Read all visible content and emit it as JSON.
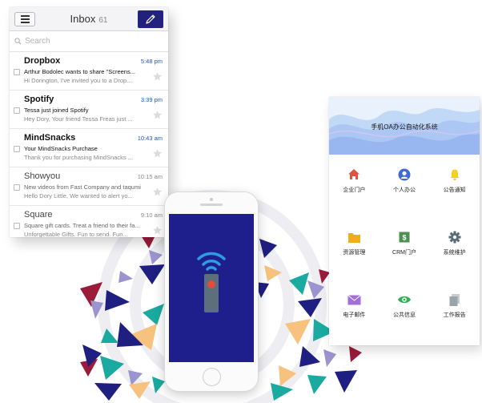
{
  "inbox": {
    "title": "Inbox",
    "count": "61",
    "search_placeholder": "Search",
    "messages": [
      {
        "sender": "Dropbox",
        "time": "5:48 pm",
        "subject": "Arthur Bodolec wants to share \"Screens...",
        "preview": "Hi Dorington, I've invited you to a Drop...",
        "unread": true
      },
      {
        "sender": "Spotify",
        "time": "3:39 pm",
        "subject": "Tessa just joined Spotify",
        "preview": "Hey Dory, Your friend Tessa Freas just ...",
        "unread": true
      },
      {
        "sender": "MindSnacks",
        "time": "10:43 am",
        "subject": "Your MindSnacks Purchase",
        "preview": "Thank you for purchasing MindSnacks ...",
        "unread": true
      },
      {
        "sender": "Showyou",
        "time": "10:15 am",
        "subject": "New videos from Fast Company and taqumi",
        "preview": "Hello Dory Little, We wanted to alert yo...",
        "unread": false
      },
      {
        "sender": "Square",
        "time": "9:10 am",
        "subject": "Square gift cards. Treat a friend to their fa...",
        "preview": "Unforgettable Gifts. Fun to send. Fun...",
        "unread": false
      }
    ]
  },
  "phone": {
    "screen_icon": "wifi-remote-icon",
    "colors": {
      "screen": "#1e1e8c",
      "signal": "#2f9be6",
      "remote": "#5c6f7d",
      "button": "#e24c3a"
    }
  },
  "oa": {
    "title": "手机OA办公自动化系统",
    "items": [
      {
        "label": "企业门户",
        "icon": "home-icon",
        "color": "#e0533f"
      },
      {
        "label": "个人办公",
        "icon": "person-icon",
        "color": "#3f6ad8"
      },
      {
        "label": "公告通知",
        "icon": "bell-icon",
        "color": "#f1d21e"
      },
      {
        "label": "资源管理",
        "icon": "folder-icon",
        "color": "#f2ae14"
      },
      {
        "label": "CRM门户",
        "icon": "crm-icon",
        "color": "#4e8f52"
      },
      {
        "label": "系统维护",
        "icon": "gear-icon",
        "color": "#566a78"
      },
      {
        "label": "电子邮件",
        "icon": "mail-icon",
        "color": "#a06fd8"
      },
      {
        "label": "公共信息",
        "icon": "eye-icon",
        "color": "#2eae57"
      },
      {
        "label": "工作报告",
        "icon": "report-icon",
        "color": "#9ba4ac"
      }
    ]
  },
  "colors": {
    "accent": "#22227e",
    "link": "#1a56c9",
    "triangle_navy": "#1f1f82",
    "triangle_teal": "#1aaaa0",
    "triangle_amber": "#f7c27d",
    "triangle_crimson": "#9c1b3b"
  }
}
